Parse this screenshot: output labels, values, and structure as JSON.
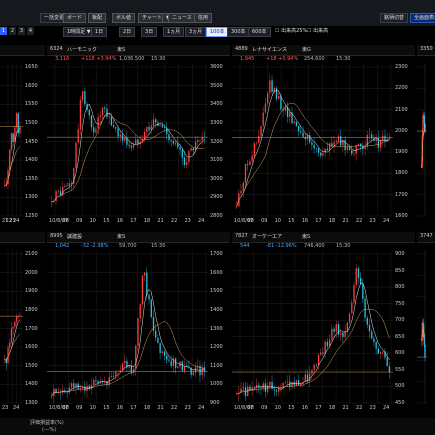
{
  "toolbar": {
    "row1": [
      "一括変更",
      "ボード",
      "板配",
      "ボル値",
      "チャート",
      "ニュース",
      "信用"
    ],
    "right_buttons": [
      "銘柄切替",
      "全画面表示"
    ],
    "pane_numbers": [
      "1",
      "2",
      "3",
      "4"
    ],
    "period_select": "1時間足",
    "ranges": [
      "1日",
      "2日",
      "3日",
      "1ヵ月",
      "3ヵ月",
      "100本",
      "300本",
      "600本"
    ],
    "active_range": "100本",
    "checkboxes": [
      "出来高25%",
      "出来高"
    ]
  },
  "colors": {
    "up_candle": "#ff4040",
    "down_candle": "#23c8e8",
    "ma1": "#e8e8e8",
    "ma2": "#d0a060",
    "accent": "#2a5fff"
  },
  "panes": [
    {
      "slot": 0,
      "code": "",
      "name": "",
      "market": "",
      "price": "",
      "change": "",
      "volume": "",
      "time": "",
      "y_ticks": [
        "1650",
        "1600",
        "1550",
        "1500",
        "1450",
        "1400",
        "1350",
        "1300",
        "1250"
      ],
      "x_ticks": [
        "21",
        "22",
        "23",
        "24"
      ]
    },
    {
      "slot": 1,
      "code": "6324",
      "name": "ハーモニック",
      "market": "東S",
      "price": "3,116",
      "change": "+118 +3.94%",
      "volume": "1,036,500",
      "time": "15:30",
      "y_ticks": [
        "3600",
        "3500",
        "3400",
        "3300",
        "3200",
        "3100",
        "3000",
        "2900",
        "2800"
      ],
      "x_ticks": [
        "10/8/07",
        "08",
        "09",
        "10",
        "15",
        "16",
        "17",
        "18",
        "21",
        "22",
        "23",
        "24"
      ]
    },
    {
      "slot": 2,
      "code": "4889",
      "name": "レナサイエンス",
      "market": "東G",
      "price": "1,945",
      "change": "+18 +0.94%",
      "volume": "254,600",
      "time": "15:30",
      "y_ticks": [
        "2300",
        "2200",
        "2100",
        "2000",
        "1900",
        "1800",
        "1700",
        "1600"
      ],
      "x_ticks": [
        "10/8/07",
        "08",
        "09",
        "10",
        "15",
        "16",
        "17",
        "18",
        "21",
        "22",
        "23",
        "24"
      ]
    },
    {
      "slot": 3,
      "code": "3350",
      "name": "",
      "market": "",
      "price": "",
      "change": "",
      "volume": "",
      "time": "",
      "y_ticks": [],
      "x_ticks": []
    },
    {
      "slot": 4,
      "code": "",
      "name": "",
      "market": "",
      "price": "",
      "change": "",
      "volume": "",
      "time": "",
      "y_ticks": [
        "2100",
        "2000",
        "1900",
        "1800",
        "1700",
        "1600",
        "1500",
        "1400",
        "1300"
      ],
      "x_ticks": [
        "23",
        "24"
      ]
    },
    {
      "slot": 5,
      "code": "8995",
      "name": "誠建設",
      "market": "東S",
      "price": "1,042",
      "change": "-32 -2.98%",
      "volume": "59,700",
      "time": "15:30",
      "y_ticks": [
        "1700",
        "1600",
        "1500",
        "1400",
        "1300",
        "1200",
        "1100",
        "1000",
        "900"
      ],
      "x_ticks": [
        "10/8/07",
        "08",
        "09",
        "10",
        "15",
        "16",
        "17",
        "18",
        "21",
        "22",
        "23",
        "24"
      ]
    },
    {
      "slot": 6,
      "code": "7827",
      "name": "オーケーエア",
      "market": "東S",
      "price": "544",
      "change": "-81 -12.96%",
      "volume": "746,400",
      "time": "15:30",
      "y_ticks": [
        "900",
        "850",
        "800",
        "750",
        "700",
        "650",
        "600",
        "550",
        "500",
        "450"
      ],
      "x_ticks": [
        "10/8/07",
        "08",
        "09",
        "10",
        "15",
        "16",
        "17",
        "18",
        "21",
        "22",
        "23",
        "24"
      ]
    },
    {
      "slot": 7,
      "code": "3747",
      "name": "",
      "market": "",
      "price": "",
      "change": "",
      "volume": "",
      "time": "",
      "y_ticks": [],
      "x_ticks": []
    }
  ],
  "bottom": {
    "line1": "評価損益率(%)",
    "line2": "(---%)"
  }
}
